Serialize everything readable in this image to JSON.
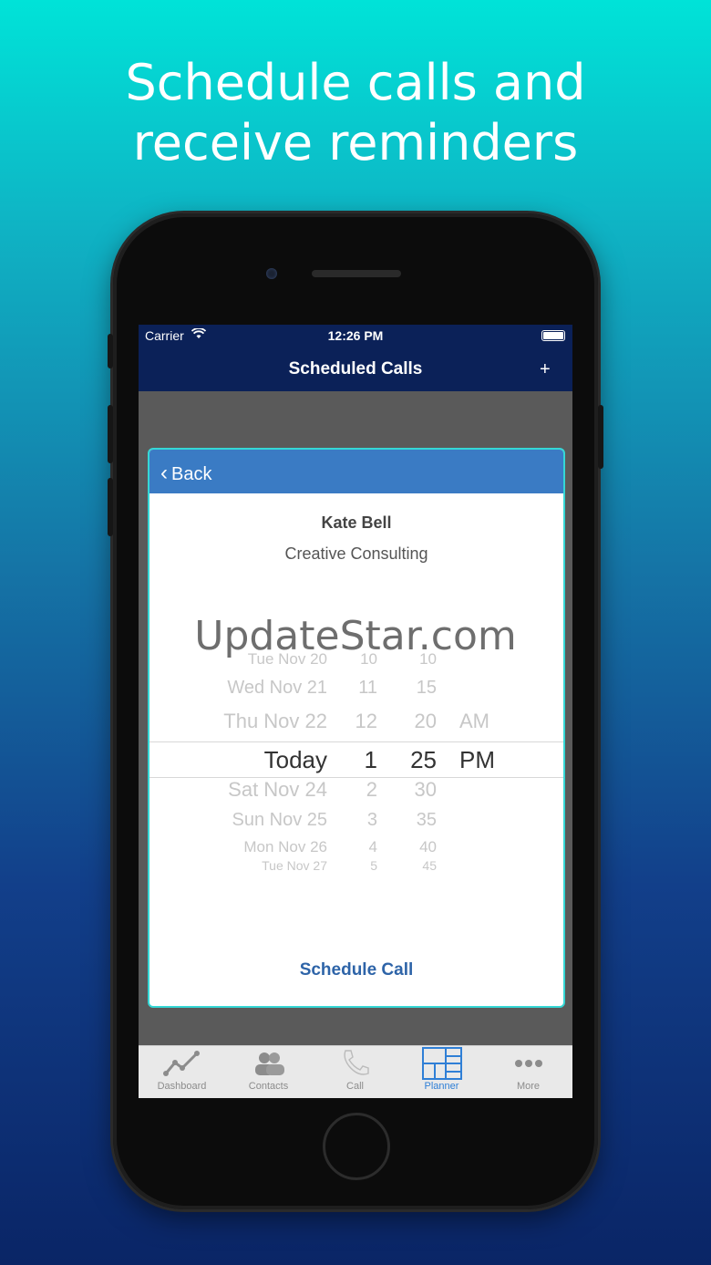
{
  "headline": {
    "line1": "Schedule calls and",
    "line2": "receive reminders"
  },
  "status": {
    "carrier": "Carrier",
    "time": "12:26 PM"
  },
  "nav": {
    "title": "Scheduled Calls",
    "add": "+"
  },
  "modal": {
    "back": "Back",
    "name": "Kate Bell",
    "company": "Creative Consulting",
    "schedule": "Schedule Call"
  },
  "picker": {
    "rows": [
      {
        "date": "Tue Nov 20",
        "hour": "10",
        "min": "10",
        "ampm": ""
      },
      {
        "date": "Wed Nov 21",
        "hour": "11",
        "min": "15",
        "ampm": ""
      },
      {
        "date": "Thu Nov 22",
        "hour": "12",
        "min": "20",
        "ampm": "AM"
      },
      {
        "date": "Today",
        "hour": "1",
        "min": "25",
        "ampm": "PM"
      },
      {
        "date": "Sat Nov 24",
        "hour": "2",
        "min": "30",
        "ampm": ""
      },
      {
        "date": "Sun Nov 25",
        "hour": "3",
        "min": "35",
        "ampm": ""
      },
      {
        "date": "Mon Nov 26",
        "hour": "4",
        "min": "40",
        "ampm": ""
      },
      {
        "date": "Tue Nov 27",
        "hour": "5",
        "min": "45",
        "ampm": ""
      }
    ]
  },
  "tabs": [
    {
      "label": "Dashboard",
      "icon": "dashboard-icon"
    },
    {
      "label": "Contacts",
      "icon": "contacts-icon"
    },
    {
      "label": "Call",
      "icon": "phone-icon"
    },
    {
      "label": "Planner",
      "icon": "planner-icon"
    },
    {
      "label": "More",
      "icon": "more-icon"
    }
  ],
  "watermark": "UpdateStar.com",
  "colors": {
    "nav": "#0b2158",
    "modal_header": "#3a7bc4",
    "accent": "#2f7fd6",
    "modal_border": "#35d7d5"
  }
}
